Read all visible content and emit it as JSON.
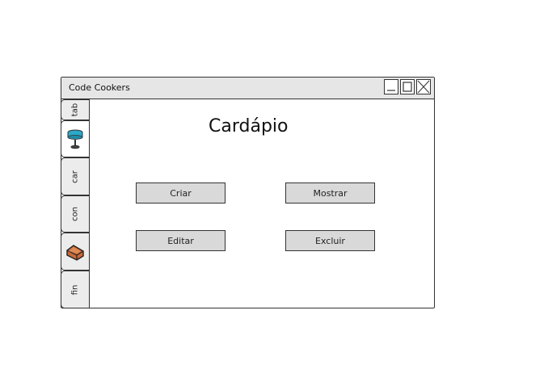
{
  "window": {
    "title": "Code Cookers"
  },
  "tabs": [
    {
      "label": "tab",
      "icon": ""
    },
    {
      "label": "",
      "icon": "drink-icon"
    },
    {
      "label": "car",
      "icon": ""
    },
    {
      "label": "con",
      "icon": ""
    },
    {
      "label": "",
      "icon": "brick-icon"
    },
    {
      "label": "fin",
      "icon": ""
    }
  ],
  "main": {
    "title": "Cardápio",
    "buttons": {
      "create": "Criar",
      "show": "Mostrar",
      "edit": "Editar",
      "delete": "Excluir"
    }
  },
  "colors": {
    "button_bg": "#d9d9d9",
    "titlebar_bg": "#e6e6e6",
    "drink_blue": "#2aa9c9",
    "brick_orange": "#c86a3a"
  }
}
